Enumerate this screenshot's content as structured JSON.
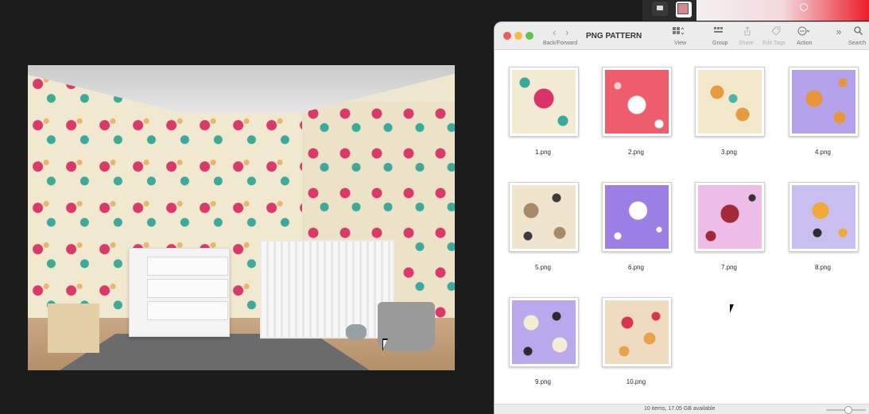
{
  "finder": {
    "title": "PNG PATTERN",
    "toolbar": {
      "back_forward_label": "Back/Forward",
      "back_icon": "‹",
      "forward_icon": "›",
      "view_label": "View",
      "group_label": "Group",
      "share_label": "Share",
      "edit_tags_label": "Edit Tags",
      "action_label": "Action",
      "search_label": "Search"
    },
    "files": [
      {
        "name": "1.png"
      },
      {
        "name": "2.png"
      },
      {
        "name": "3.png"
      },
      {
        "name": "4.png"
      },
      {
        "name": "5.png"
      },
      {
        "name": "6.png"
      },
      {
        "name": "7.png"
      },
      {
        "name": "8.png"
      },
      {
        "name": "9.png"
      },
      {
        "name": "10.png"
      }
    ],
    "status": "10 items, 17.05 GB available"
  },
  "colors": {
    "close": "#ee5d55",
    "minimize": "#f2bd3c",
    "maximize": "#60c453",
    "selected_swatch": "#d9868f"
  },
  "icons": [
    "view-grid-icon",
    "group-icon",
    "share-icon",
    "tag-icon",
    "action-ellipsis-icon",
    "more-chevrons-icon",
    "search-icon"
  ]
}
